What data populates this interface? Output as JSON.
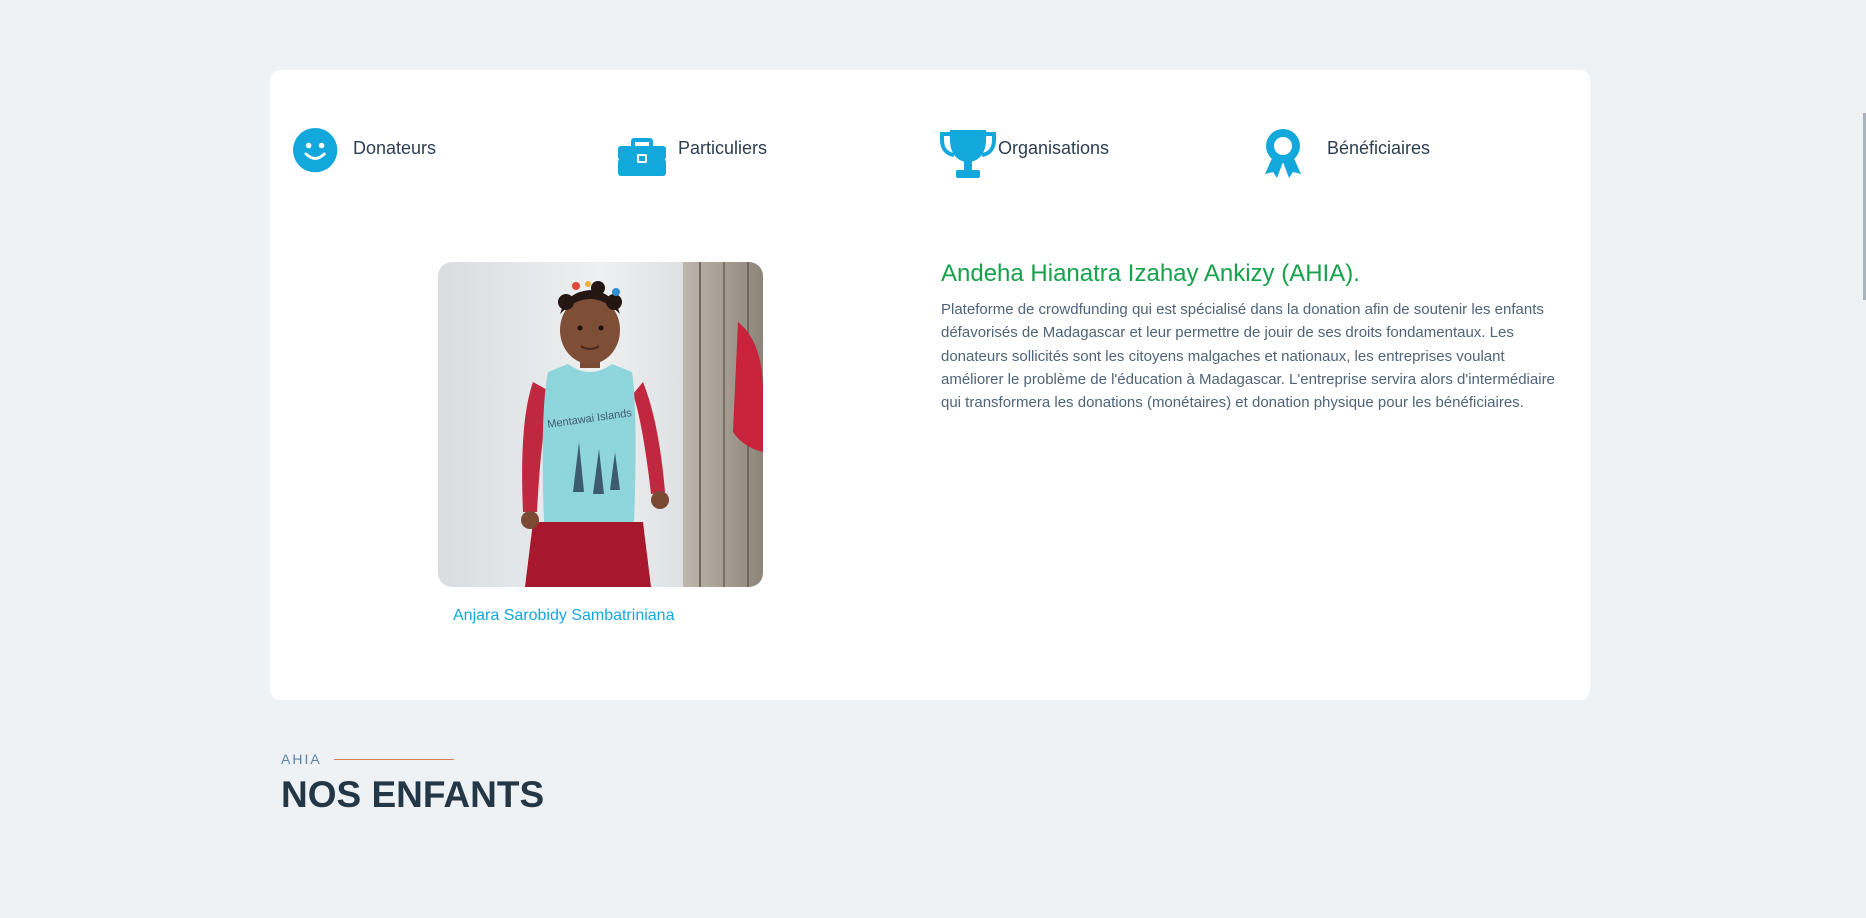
{
  "colors": {
    "page_background": "#eff2f5",
    "card_background": "#ffffff",
    "icon_accent": "#12a8dc",
    "title_green": "#14a24a",
    "eyebrow_line": "#e07b5a"
  },
  "features": [
    {
      "icon": "smiley-icon",
      "label": "Donateurs"
    },
    {
      "icon": "briefcase-icon",
      "label": "Particuliers"
    },
    {
      "icon": "trophy-icon",
      "label": "Organisations"
    },
    {
      "icon": "award-ribbon-icon",
      "label": "Bénéficiaires"
    }
  ],
  "featured_child": {
    "caption": "Anjara Sarobidy Sambatriniana",
    "photo_shirt_text": "Mentawai Islands"
  },
  "about": {
    "title": "Andeha Hianatra Izahay Ankizy (AHIA).",
    "text": "Plateforme de crowdfunding qui est spécialisé dans la donation afin de soutenir les enfants défavorisés de Madagascar et leur permettre de jouir de ses droits fondamentaux. Les donateurs sollicités sont les citoyens malgaches et nationaux, les entreprises voulant améliorer le problème de l'éducation à Madagascar. L'entreprise servira alors d'intermédiaire qui transformera les donations (monétaires) et donation physique pour les bénéficiaires."
  },
  "section": {
    "eyebrow": "AHIA",
    "title": "NOS ENFANTS"
  }
}
